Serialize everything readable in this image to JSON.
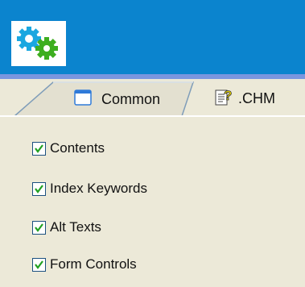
{
  "header": {
    "logo_icon": "gears-icon"
  },
  "tabs": [
    {
      "label": "Common",
      "icon": "window-icon",
      "active": false
    },
    {
      "label": ".CHM",
      "icon": "help-file-icon",
      "active": true
    }
  ],
  "options": [
    {
      "label": "Contents",
      "checked": true
    },
    {
      "label": "Index Keywords",
      "checked": true
    },
    {
      "label": "Alt Texts",
      "checked": true
    },
    {
      "label": "Form Controls",
      "checked": true
    }
  ],
  "colors": {
    "header_blue": "#0b84ce",
    "panel_bg": "#ece9d8",
    "check_green": "#21a121",
    "gear_cyan": "#1aa7e0",
    "gear_green": "#3dae1f"
  }
}
